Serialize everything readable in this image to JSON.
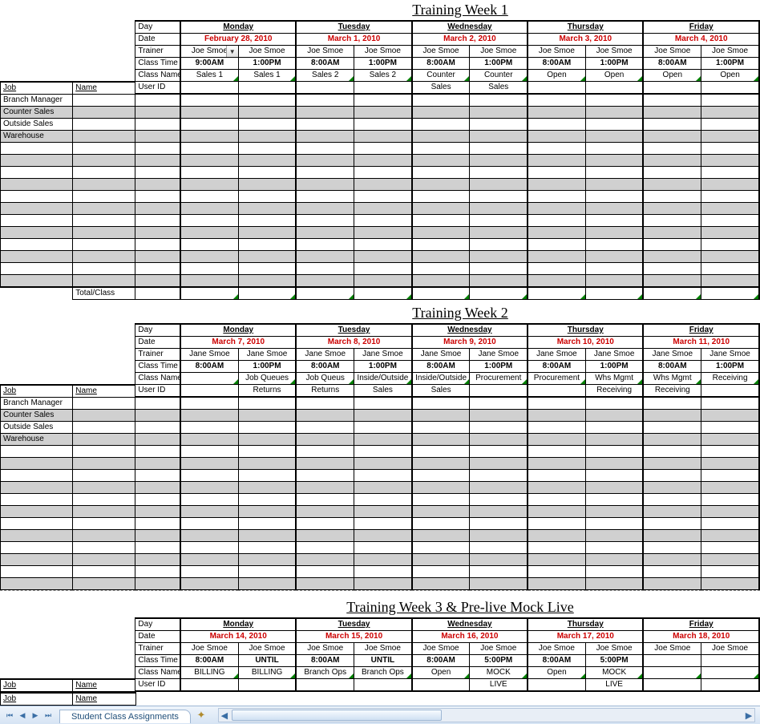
{
  "row_labels": {
    "day": "Day",
    "date": "Date",
    "trainer": "Trainer",
    "class_time": "Class Time",
    "class_name": "Class Name",
    "job": "Job",
    "name": "Name",
    "user_id": "User ID",
    "total_class": "Total/Class"
  },
  "jobs": [
    "Branch Manager",
    "Counter Sales",
    "Outside Sales",
    "Warehouse"
  ],
  "week1": {
    "title": "Training Week 1",
    "days": [
      {
        "day": "Monday",
        "date": "February 28, 2010",
        "trainer": [
          "Joe Smoe",
          "Joe Smoe"
        ],
        "time": [
          "9:00AM",
          "1:00PM"
        ],
        "class": [
          "Sales 1",
          "Sales 1"
        ]
      },
      {
        "day": "Tuesday",
        "date": "March 1, 2010",
        "trainer": [
          "Joe Smoe",
          "Joe Smoe"
        ],
        "time": [
          "8:00AM",
          "1:00PM"
        ],
        "class": [
          "Sales 2",
          "Sales 2"
        ]
      },
      {
        "day": "Wednesday",
        "date": "March 2, 2010",
        "trainer": [
          "Joe Smoe",
          "Joe Smoe"
        ],
        "time": [
          "8:00AM",
          "1:00PM"
        ],
        "class": [
          "Counter",
          "Counter"
        ]
      },
      {
        "day": "Thursday",
        "date": "March 3, 2010",
        "trainer": [
          "Joe Smoe",
          "Joe Smoe"
        ],
        "time": [
          "8:00AM",
          "1:00PM"
        ],
        "class": [
          "Open",
          "Open"
        ]
      },
      {
        "day": "Friday",
        "date": "March 4, 2010",
        "trainer": [
          "Joe Smoe",
          "Joe Smoe"
        ],
        "time": [
          "8:00AM",
          "1:00PM"
        ],
        "class": [
          "Open",
          "Open"
        ]
      }
    ],
    "extra_class_row": [
      "Sales",
      "Sales"
    ]
  },
  "week2": {
    "title": "Training Week 2",
    "days": [
      {
        "day": "Monday",
        "date": "March 7, 2010",
        "trainer": [
          "Jane Smoe",
          "Jane Smoe"
        ],
        "time": [
          "8:00AM",
          "1:00PM"
        ],
        "class": [
          "",
          "Job Queues"
        ]
      },
      {
        "day": "Tuesday",
        "date": "March 8, 2010",
        "trainer": [
          "Jane Smoe",
          "Jane Smoe"
        ],
        "time": [
          "8:00AM",
          "1:00PM"
        ],
        "class": [
          "Job Queus",
          "Inside/Outside"
        ]
      },
      {
        "day": "Wednesday",
        "date": "March 9, 2010",
        "trainer": [
          "Jane Smoe",
          "Jane Smoe"
        ],
        "time": [
          "8:00AM",
          "1:00PM"
        ],
        "class": [
          "Inside/Outside",
          "Procurement"
        ]
      },
      {
        "day": "Thursday",
        "date": "March 10, 2010",
        "trainer": [
          "Jane Smoe",
          "Jane Smoe"
        ],
        "time": [
          "8:00AM",
          "1:00PM"
        ],
        "class": [
          "Procurement",
          "Whs Mgmt"
        ]
      },
      {
        "day": "Friday",
        "date": "March 11, 2010",
        "trainer": [
          "Jane Smoe",
          "Jane Smoe"
        ],
        "time": [
          "8:00AM",
          "1:00PM"
        ],
        "class": [
          "Whs Mgmt",
          "Receiving"
        ]
      }
    ],
    "extra_class_row": [
      "",
      "Returns",
      "Returns",
      "Sales",
      "Sales",
      "",
      "",
      "Receiving",
      "Receiving",
      ""
    ]
  },
  "week3": {
    "title": "Training Week 3 & Pre-live Mock Live",
    "days": [
      {
        "day": "Monday",
        "date": "March 14, 2010",
        "trainer": [
          "Joe Smoe",
          "Joe Smoe"
        ],
        "time": [
          "8:00AM",
          "UNTIL"
        ],
        "class": [
          "BILLING",
          "BILLING"
        ]
      },
      {
        "day": "Tuesday",
        "date": "March 15, 2010",
        "trainer": [
          "Joe Smoe",
          "Joe Smoe"
        ],
        "time": [
          "8:00AM",
          "UNTIL"
        ],
        "class": [
          "Branch Ops",
          "Branch Ops"
        ]
      },
      {
        "day": "Wednesday",
        "date": "March 16, 2010",
        "trainer": [
          "Joe Smoe",
          "Joe Smoe"
        ],
        "time": [
          "8:00AM",
          "5:00PM"
        ],
        "class": [
          "Open",
          "MOCK"
        ]
      },
      {
        "day": "Thursday",
        "date": "March 17, 2010",
        "trainer": [
          "Joe Smoe",
          "Joe Smoe"
        ],
        "time": [
          "8:00AM",
          "5:00PM"
        ],
        "class": [
          "Open",
          "MOCK"
        ]
      },
      {
        "day": "Friday",
        "date": "March 18, 2010",
        "trainer": [
          "Joe Smoe",
          "Joe Smoe"
        ],
        "time": [
          "",
          ""
        ],
        "class": [
          "",
          ""
        ]
      }
    ],
    "extra_class_row": [
      "",
      "",
      "",
      "",
      "",
      "LIVE",
      "",
      "LIVE",
      "",
      ""
    ]
  },
  "tab": {
    "name": "Student Class Assignments"
  }
}
